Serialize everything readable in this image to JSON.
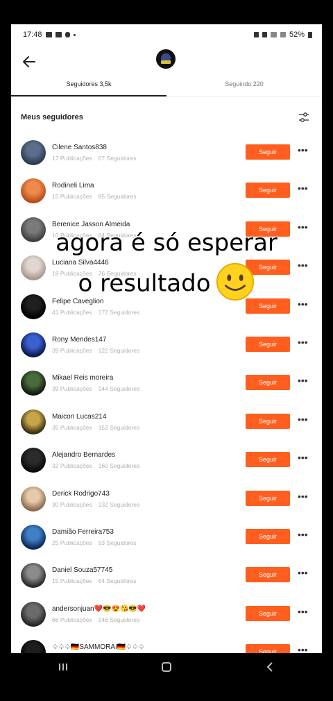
{
  "status_bar": {
    "time": "17:48",
    "battery": "52%"
  },
  "header": {
    "avatar_icon": "channel-logo-icon"
  },
  "tabs": [
    {
      "label": "Seguidores 3,5k",
      "active": true
    },
    {
      "label": "Seguindo 220",
      "active": false
    }
  ],
  "section": {
    "title": "Meus seguidores"
  },
  "overlay": {
    "line1": "agora é só esperar",
    "line2": "o resultado"
  },
  "colors": {
    "accent": "#ff5e1f"
  },
  "followers": [
    {
      "name": "Cilene Santos838",
      "posts": "17 Publicações",
      "followers": "67 Seguidores",
      "button": "Seguir"
    },
    {
      "name": "Rodineli Lima",
      "posts": "15 Publicações",
      "followers": "85 Seguidores",
      "button": "Seguir"
    },
    {
      "name": "Berenice Jasson Almeida",
      "posts": "10 Publicações",
      "followers": "64 Seguidores",
      "button": "Seguir"
    },
    {
      "name": "Luciana Silva4446",
      "posts": "18 Publicações",
      "followers": "76 Seguidores",
      "button": "Seguir"
    },
    {
      "name": "Felipe Caveglion",
      "posts": "41 Publicações",
      "followers": "172 Seguidores",
      "button": "Seguir"
    },
    {
      "name": "Rony Mendes147",
      "posts": "39 Publicações",
      "followers": "122 Seguidores",
      "button": "Seguir"
    },
    {
      "name": "Mikael Reis moreira",
      "posts": "39 Publicações",
      "followers": "144 Seguidores",
      "button": "Seguir"
    },
    {
      "name": "Maicon Lucas214",
      "posts": "35 Publicações",
      "followers": "153 Seguidores",
      "button": "Seguir"
    },
    {
      "name": "Alejandro Bernardes",
      "posts": "32 Publicações",
      "followers": "160 Seguidores",
      "button": "Seguir"
    },
    {
      "name": "Derick Rodrigo743",
      "posts": "30 Publicações",
      "followers": "132 Seguidores",
      "button": "Seguir"
    },
    {
      "name": "Damião Ferreira753",
      "posts": "25 Publicações",
      "followers": "93 Seguidores",
      "button": "Seguir"
    },
    {
      "name": "Daniel Souza57745",
      "posts": "15 Publicações",
      "followers": "64 Seguidores",
      "button": "Seguir"
    },
    {
      "name": "andersonjuan❤️😎😍😘😎❤️",
      "posts": "68 Publicações",
      "followers": "248 Seguidores",
      "button": "Seguir"
    },
    {
      "name": "♤♤♤🇩🇪SAMMORAI🇩🇪♤♤♤",
      "posts": "",
      "followers": "",
      "button": "Seguir"
    }
  ]
}
